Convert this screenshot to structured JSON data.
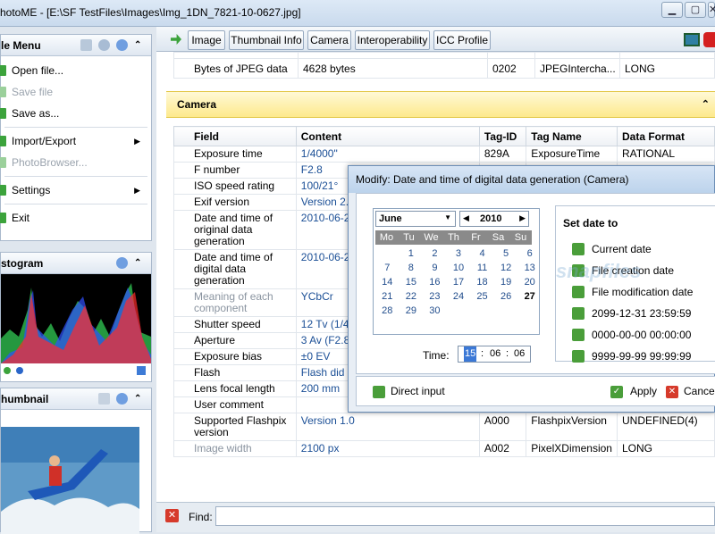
{
  "window": {
    "title": "hotoME - [E:\\SF TestFiles\\Images\\Img_1DN_7821-10-0627.jpg]",
    "min": "▁",
    "max": "▢",
    "close": "✕"
  },
  "sidebar": {
    "file_menu": {
      "title": "le Menu",
      "items": [
        "Open file...",
        "Save file",
        "Save as...",
        "Import/Export",
        "PhotoBrowser...",
        "Settings",
        "Exit"
      ]
    },
    "histogram": {
      "title": "stogram"
    },
    "thumbnail": {
      "title": "humbnail"
    }
  },
  "toolbar": {
    "tabs": [
      "Image",
      "Thumbnail Info",
      "Camera",
      "Interoperability",
      "ICC Profile"
    ]
  },
  "top_row": {
    "field": "Bytes of JPEG data",
    "content": "4628 bytes",
    "tag": "0202",
    "tagname": "JPEGIntercha...",
    "format": "LONG"
  },
  "camera": {
    "title": "Camera",
    "columns": [
      "Field",
      "Content",
      "Tag-ID",
      "Tag Name",
      "Data Format"
    ],
    "rows": [
      {
        "field": "Exposure time",
        "content": "1/4000\"",
        "tag": "829A",
        "name": "ExposureTime",
        "format": "RATIONAL"
      },
      {
        "field": "F number",
        "content": "F2.8",
        "tag": "",
        "name": "",
        "format": ""
      },
      {
        "field": "ISO speed rating",
        "content": "100/21°",
        "tag": "",
        "name": "",
        "format": ""
      },
      {
        "field": "Exif version",
        "content": "Version 2.",
        "tag": "",
        "name": "",
        "format": ""
      },
      {
        "field": "Date and time of original data generation",
        "content": "2010-06-2",
        "tag": "",
        "name": "",
        "format": ""
      },
      {
        "field": "Date and time of digital data generation",
        "content": "2010-06-2",
        "tag": "",
        "name": "",
        "format": ""
      },
      {
        "field": "Meaning of each component",
        "content": "YCbCr",
        "tag": "",
        "name": "",
        "format": ""
      },
      {
        "field": "Shutter speed",
        "content": "12 Tv (1/4",
        "tag": "",
        "name": "",
        "format": ""
      },
      {
        "field": "Aperture",
        "content": "3 Av (F2.8",
        "tag": "",
        "name": "",
        "format": ""
      },
      {
        "field": "Exposure bias",
        "content": "±0 EV",
        "tag": "",
        "name": "",
        "format": ""
      },
      {
        "field": "Flash",
        "content": "Flash did n mode",
        "tag": "",
        "name": "",
        "format": ""
      },
      {
        "field": "Lens focal length",
        "content": "200 mm",
        "tag": "920A",
        "name": "FocalLength",
        "format": "RATIONAL"
      },
      {
        "field": "User comment",
        "content": "",
        "tag": "9286",
        "name": "UserComment",
        "format": "UNDEFINED(264)"
      },
      {
        "field": "Supported Flashpix version",
        "content": "Version 1.0",
        "tag": "A000",
        "name": "FlashpixVersion",
        "format": "UNDEFINED(4)"
      },
      {
        "field": "Image width",
        "content": "2100 px",
        "tag": "A002",
        "name": "PixelXDimension",
        "format": "LONG"
      }
    ]
  },
  "find": {
    "label": "Find:",
    "value": ""
  },
  "dialog": {
    "title": "Modify: Date and time of digital data generation (Camera)",
    "month": "June",
    "year": "2010",
    "weekdays": [
      "Mo",
      "Tu",
      "We",
      "Th",
      "Fr",
      "Sa",
      "Su"
    ],
    "weeks": [
      [
        "",
        "1",
        "2",
        "3",
        "4",
        "5",
        "6"
      ],
      [
        "7",
        "8",
        "9",
        "10",
        "11",
        "12",
        "13"
      ],
      [
        "14",
        "15",
        "16",
        "17",
        "18",
        "19",
        "20"
      ],
      [
        "21",
        "22",
        "23",
        "24",
        "25",
        "26",
        "27"
      ],
      [
        "28",
        "29",
        "30",
        "",
        "",
        "",
        ""
      ]
    ],
    "today": "27",
    "time_label": "Time:",
    "hour": "15",
    "minute": "06",
    "second": "06",
    "set_date": {
      "title": "Set date to",
      "options": [
        "Current date",
        "File creation date",
        "File modification date",
        "2099-12-31 23:59:59",
        "0000-00-00 00:00:00",
        "9999-99-99 99:99:99"
      ]
    },
    "direct_input": "Direct input",
    "apply": "Apply",
    "cancel": "Cancel"
  },
  "watermark": "snapfiles"
}
